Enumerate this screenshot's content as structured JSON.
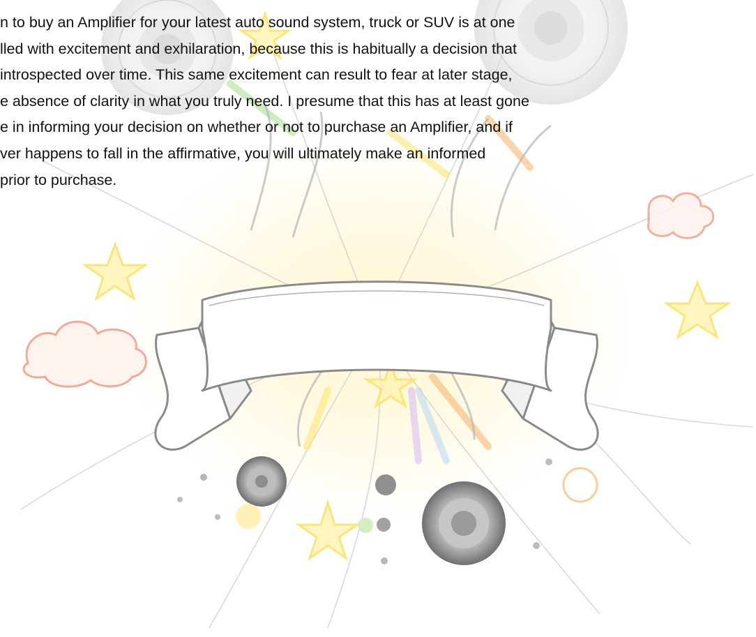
{
  "document": {
    "paragraph_lines": [
      "n to buy an Amplifier for your latest auto sound system, truck or SUV is at one",
      "lled with excitement and exhilaration, because this is habitually a decision that",
      "introspected over time. This same excitement can result to fear at later stage,",
      "e absence of clarity in what you truly need. I presume that this has at least gone",
      "e in informing your decision on whether or not to purchase an Amplifier, and if",
      "ver happens to fall in the affirmative, you will ultimately make an informed",
      "prior to purchase."
    ]
  },
  "background": {
    "colors": {
      "star_yellow": "#fbe36a",
      "cloud_red": "#f0a28a",
      "speaker_gray": "#9a9a9a",
      "ribbon_stroke": "#8a8a8a",
      "accent_green": "#a6dd8a",
      "accent_orange": "#f6b36a"
    }
  }
}
